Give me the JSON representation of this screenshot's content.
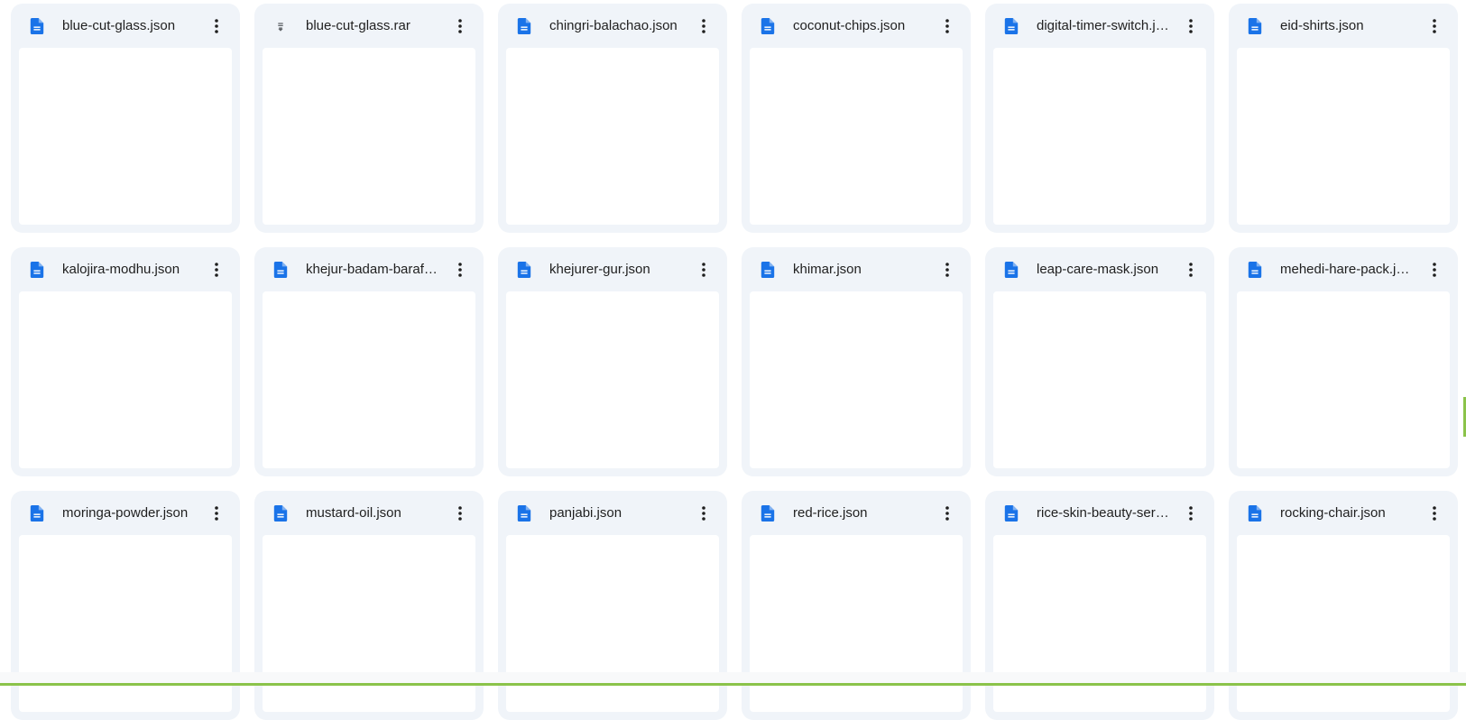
{
  "colors": {
    "card_bg": "#f0f4f9",
    "doc_icon": "#1a73e8",
    "archive_icon": "#5f6368",
    "accent": "#8bc34a"
  },
  "files": [
    {
      "name": "blue-cut-glass.json",
      "icon": "doc-icon"
    },
    {
      "name": "blue-cut-glass.rar",
      "icon": "archive-icon"
    },
    {
      "name": "chingri-balachao.json",
      "icon": "doc-icon"
    },
    {
      "name": "coconut-chips.json",
      "icon": "doc-icon"
    },
    {
      "name": "digital-timer-switch.json",
      "icon": "doc-icon"
    },
    {
      "name": "eid-shirts.json",
      "icon": "doc-icon"
    },
    {
      "name": "kalojira-modhu.json",
      "icon": "doc-icon"
    },
    {
      "name": "khejur-badam-barafi.json",
      "icon": "doc-icon"
    },
    {
      "name": "khejurer-gur.json",
      "icon": "doc-icon"
    },
    {
      "name": "khimar.json",
      "icon": "doc-icon"
    },
    {
      "name": "leap-care-mask.json",
      "icon": "doc-icon"
    },
    {
      "name": "mehedi-hare-pack.json",
      "icon": "doc-icon"
    },
    {
      "name": "moringa-powder.json",
      "icon": "doc-icon"
    },
    {
      "name": "mustard-oil.json",
      "icon": "doc-icon"
    },
    {
      "name": "panjabi.json",
      "icon": "doc-icon"
    },
    {
      "name": "red-rice.json",
      "icon": "doc-icon"
    },
    {
      "name": "rice-skin-beauty-serum.json",
      "icon": "doc-icon"
    },
    {
      "name": "rocking-chair.json",
      "icon": "doc-icon"
    }
  ]
}
